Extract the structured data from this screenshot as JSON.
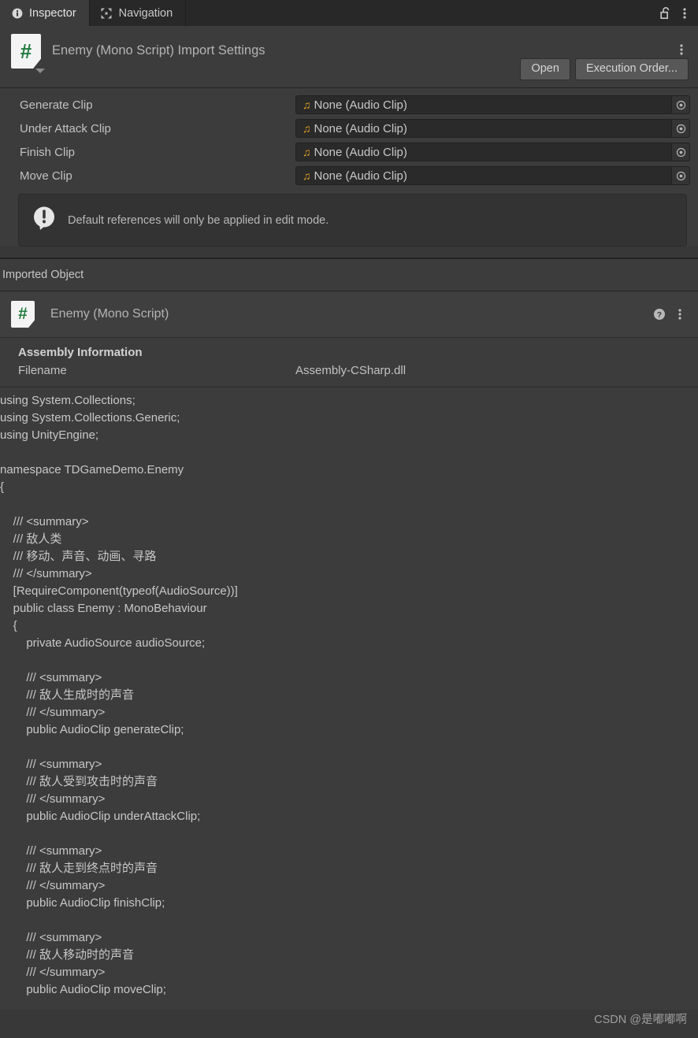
{
  "window": {
    "tabs": [
      {
        "label": "Inspector",
        "icon": "info-circle-icon",
        "active": true
      },
      {
        "label": "Navigation",
        "icon": "move-arrows-icon",
        "active": false
      }
    ],
    "lock_icon": "unlocked-padlock-icon",
    "menu_icon": "vertical-ellipsis-icon"
  },
  "importer": {
    "icon_glyph": "#",
    "title": "Enemy (Mono Script) Import Settings",
    "menu_icon": "vertical-ellipsis-icon",
    "buttons": {
      "open": "Open",
      "execution_order": "Execution Order..."
    },
    "properties": [
      {
        "label": "Generate Clip",
        "value": "None (Audio Clip)",
        "type_icon": "music-note-icon"
      },
      {
        "label": "Under Attack Clip",
        "value": "None (Audio Clip)",
        "type_icon": "music-note-icon"
      },
      {
        "label": "Finish Clip",
        "value": "None (Audio Clip)",
        "type_icon": "music-note-icon"
      },
      {
        "label": "Move Clip",
        "value": "None (Audio Clip)",
        "type_icon": "music-note-icon"
      }
    ],
    "helpbox": {
      "icon": "info-exclamation-icon",
      "message": "Default references will only be applied in edit mode."
    }
  },
  "imported_object": {
    "section_label": "Imported Object",
    "component_title": "Enemy (Mono Script)",
    "component_icon_glyph": "#",
    "help_icon": "question-circle-icon",
    "menu_icon": "vertical-ellipsis-icon",
    "assembly": {
      "title": "Assembly Information",
      "filename_label": "Filename",
      "filename_value": "Assembly-CSharp.dll"
    },
    "source_code": "using System.Collections;\nusing System.Collections.Generic;\nusing UnityEngine;\n\nnamespace TDGameDemo.Enemy\n{\n\n    /// <summary>\n    /// 敌人类\n    /// 移动、声音、动画、寻路\n    /// </summary>\n    [RequireComponent(typeof(AudioSource))]\n    public class Enemy : MonoBehaviour\n    {\n        private AudioSource audioSource;\n\n        /// <summary>\n        /// 敌人生成时的声音\n        /// </summary>\n        public AudioClip generateClip;\n\n        /// <summary>\n        /// 敌人受到攻击时的声音\n        /// </summary>\n        public AudioClip underAttackClip;\n\n        /// <summary>\n        /// 敌人走到终点时的声音\n        /// </summary>\n        public AudioClip finishClip;\n\n        /// <summary>\n        /// 敌人移动时的声音\n        /// </summary>\n        public AudioClip moveClip;"
  },
  "watermark": "CSDN @是嘟嘟啊",
  "colors": {
    "panel_bg": "#3c3c3c",
    "tabbar_bg": "#282828",
    "field_bg": "#2a2a2a",
    "accent_script_green": "#1f7a3d",
    "audio_icon_orange": "#e6a422",
    "text": "#c4c4c4"
  }
}
